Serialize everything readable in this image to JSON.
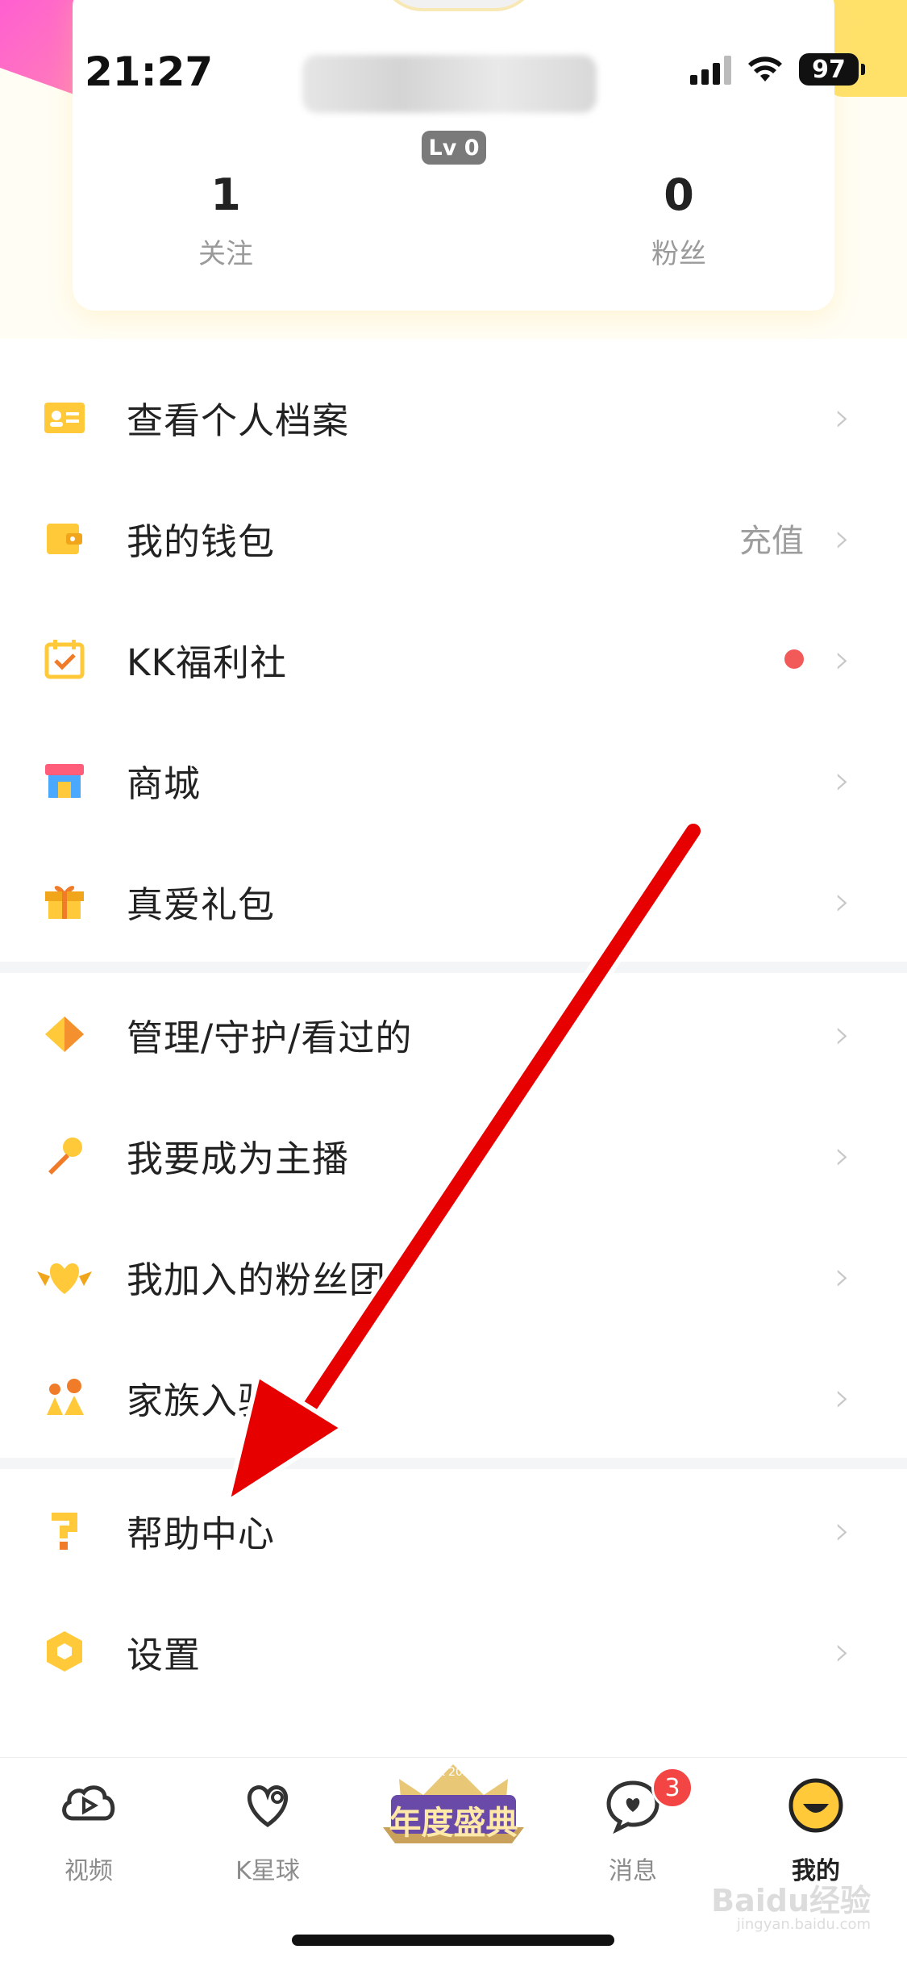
{
  "status_bar": {
    "time": "21:27",
    "battery": "97"
  },
  "profile": {
    "level": "Lv 0",
    "stats": [
      {
        "value": "1",
        "label": "关注"
      },
      {
        "value": "0",
        "label": "粉丝"
      }
    ]
  },
  "menu": {
    "group1": [
      {
        "label": "查看个人档案",
        "icon": "profile-card-icon"
      },
      {
        "label": "我的钱包",
        "right_text": "充值",
        "icon": "wallet-icon"
      },
      {
        "label": "KK福利社",
        "has_dot": true,
        "icon": "calendar-check-icon"
      },
      {
        "label": "商城",
        "icon": "store-icon"
      },
      {
        "label": "真爱礼包",
        "icon": "gift-icon"
      }
    ],
    "group2": [
      {
        "label": "管理/守护/看过的",
        "icon": "diamond-icon"
      },
      {
        "label": "我要成为主播",
        "icon": "microphone-icon"
      },
      {
        "label": "我加入的粉丝团",
        "icon": "heart-wings-icon"
      },
      {
        "label": "家族入驻",
        "icon": "family-icon"
      }
    ],
    "group3": [
      {
        "label": "帮助中心",
        "icon": "question-icon"
      },
      {
        "label": "设置",
        "icon": "settings-hex-icon"
      }
    ]
  },
  "tab_bar": {
    "tabs": [
      {
        "label": "视频",
        "icon": "video-cloud-icon"
      },
      {
        "label": "K星球",
        "icon": "heart-planet-icon"
      },
      {
        "label": "消息",
        "icon": "message-heart-icon",
        "badge": "3"
      },
      {
        "label": "我的",
        "icon": "me-smile-icon",
        "active": true
      }
    ],
    "center_banner": {
      "title": "年度盛典",
      "subtitle": "KK 2023"
    }
  },
  "watermark": {
    "main": "Baidu经验",
    "sub": "jingyan.baidu.com"
  },
  "colors": {
    "accent_yellow": "#ffc93a",
    "arrow_red": "#e60000",
    "badge_red": "#f44545"
  }
}
